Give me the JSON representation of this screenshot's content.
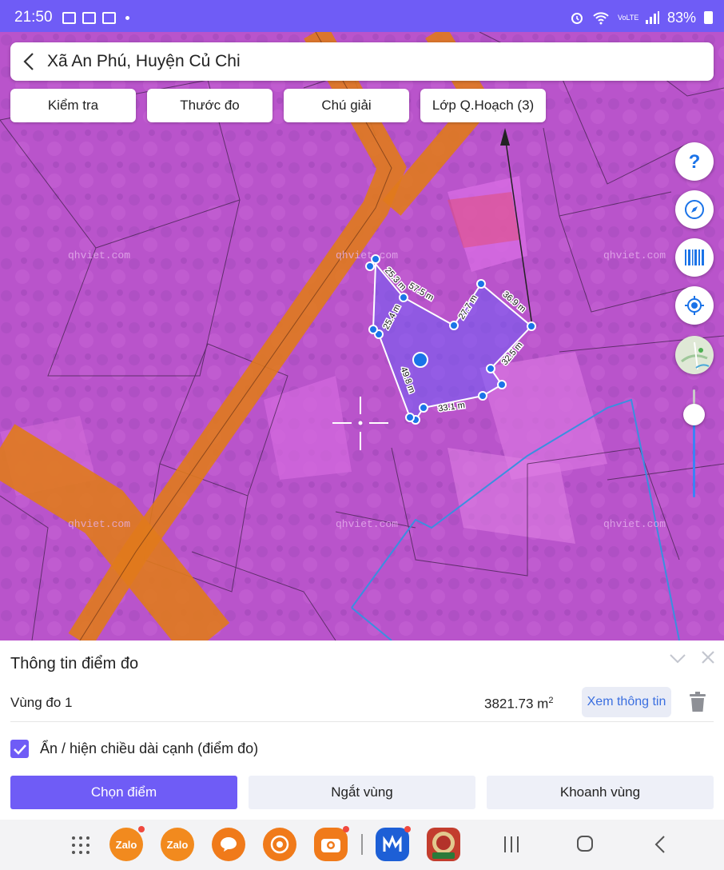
{
  "status_bar": {
    "time": "21:50",
    "battery": "83%",
    "network": "VoLTE"
  },
  "search": {
    "title": "Xã An Phú, Huyện Củ Chi"
  },
  "chips": [
    {
      "label": "Kiểm tra"
    },
    {
      "label": "Thước đo"
    },
    {
      "label": "Chú giải"
    },
    {
      "label": "Lớp Q.Hoạch (3)"
    }
  ],
  "map": {
    "watermark": "qhviet.com",
    "measurements": [
      "25.3 m",
      "57.5 m",
      "25.4 m",
      "27.7 m",
      "36.9 m",
      "32.5 m",
      "49.8 m",
      "33.1 m"
    ],
    "tools": [
      "help-icon",
      "compass-icon",
      "barcode-icon",
      "my-location-icon",
      "map-layer-icon"
    ],
    "zoom_level": 0.2,
    "colors": {
      "zone": "#c05ad0",
      "road": "#e07a1c",
      "polygon": "#6f5cf6",
      "vertex": "#1a73e8"
    }
  },
  "panel": {
    "title": "Thông tin điểm đo",
    "region_name": "Vùng đo 1",
    "area_value": "3821.73 m",
    "area_unit_sup": "2",
    "view_button": "Xem thông tin",
    "toggle_label": "Ẩn / hiện chiều dài cạnh (điểm đo)",
    "toggle_checked": true,
    "actions": [
      {
        "label": "Chọn điểm"
      },
      {
        "label": "Ngắt vùng"
      },
      {
        "label": "Khoanh vùng"
      }
    ]
  },
  "navbar": {
    "apps": [
      "Zalo",
      "Zalo"
    ]
  }
}
